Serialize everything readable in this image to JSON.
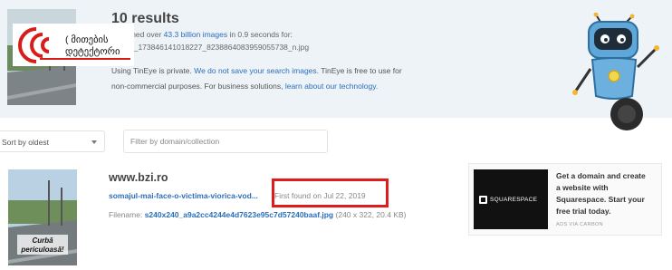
{
  "summary": {
    "results_count": "10 results",
    "search_prefix": "Searched over",
    "images_link": "43.3 billion images",
    "search_suffix": "in 0.9 seconds for:",
    "filename": "0_1738461410182​27_8238864083959055738_n.jpg",
    "private_text": "Using TinEye is private.",
    "private_link": "We do not save your search images.",
    "free_text": "TinEye is free to use for",
    "commercial_text": "non-commercial purposes. For business solutions,",
    "tech_link": "learn about our technology."
  },
  "overlay_logo": {
    "line1": "( მითების",
    "line2": "დეტექტორი"
  },
  "controls": {
    "sort_value": "Sort by oldest",
    "filter_placeholder": "Filter by domain/collection"
  },
  "result": {
    "thumb_caption_1": "Curbă",
    "thumb_caption_2": "periculoasă!",
    "domain": "www.bzi.ro",
    "page_link": "somajul-mai-face-o-victima-viorica-vod...",
    "first_found": "First found on Jul 22, 2019",
    "filename_label": "Filename:",
    "filename": "s240x240_a9a2cc4244e4d7623e95c7d57240baaf.jpg",
    "dimensions": "(240 x 322, 20.4 KB)"
  },
  "ad": {
    "logo_text": "SQUARESPACE",
    "lines": [
      "Get a domain and create",
      "a website with",
      "Squarespace. Start your",
      "free trial today."
    ],
    "via": "ADS VIA CARBON"
  },
  "colors": {
    "link": "#2a6ebb",
    "highlight": "#e01b1b",
    "band": "#eef3f8"
  }
}
